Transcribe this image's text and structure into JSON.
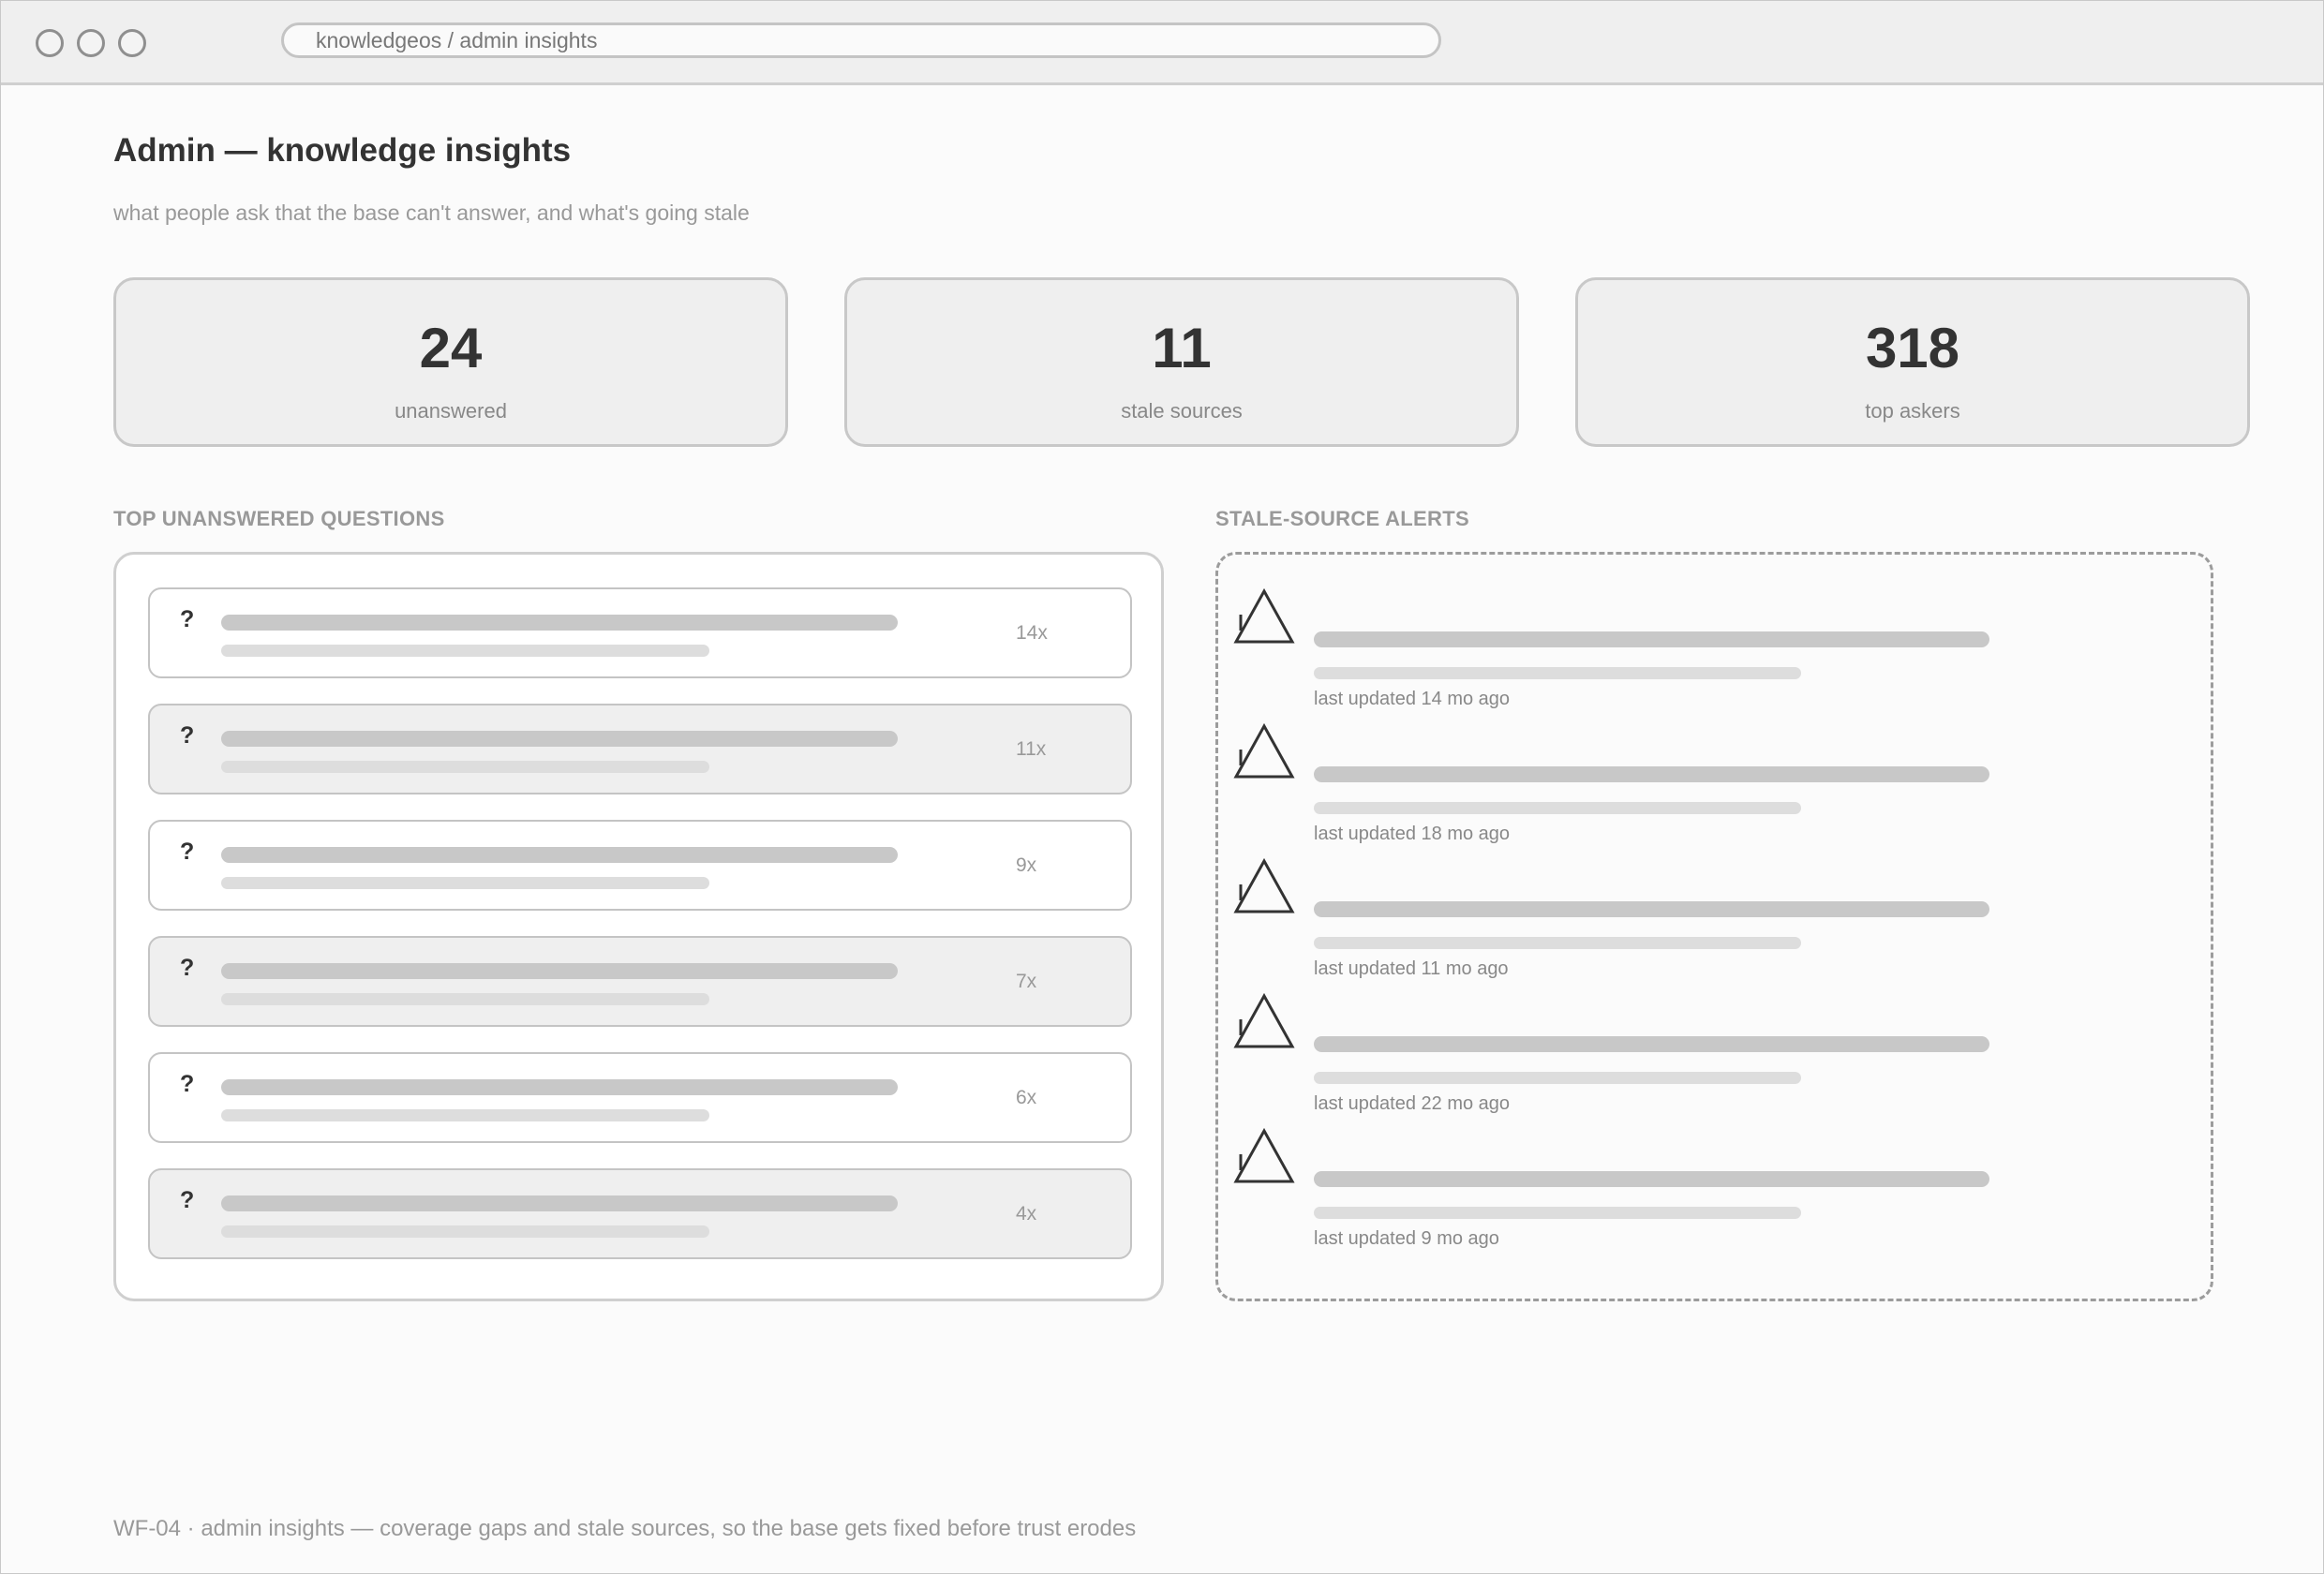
{
  "browser": {
    "address": "knowledgeos / admin insights"
  },
  "page": {
    "title": "Admin — knowledge insights",
    "subtitle": "what people ask that the base can't answer, and what's going stale"
  },
  "stats": [
    {
      "value": "24",
      "label": "unanswered"
    },
    {
      "value": "11",
      "label": "stale sources"
    },
    {
      "value": "318",
      "label": "top askers"
    }
  ],
  "questions": {
    "heading": "TOP UNANSWERED QUESTIONS",
    "items": [
      {
        "icon": "?",
        "count": "14x"
      },
      {
        "icon": "?",
        "count": "11x"
      },
      {
        "icon": "?",
        "count": "9x"
      },
      {
        "icon": "?",
        "count": "7x"
      },
      {
        "icon": "?",
        "count": "6x"
      },
      {
        "icon": "?",
        "count": "4x"
      }
    ]
  },
  "alerts": {
    "heading": "STALE-SOURCE ALERTS",
    "icon": "warning-triangle-icon",
    "items": [
      {
        "meta": "last updated 14 mo ago"
      },
      {
        "meta": "last updated 18 mo ago"
      },
      {
        "meta": "last updated 11 mo ago"
      },
      {
        "meta": "last updated 22 mo ago"
      },
      {
        "meta": "last updated 9 mo ago"
      }
    ]
  },
  "footer": {
    "caption": "WF-04 · admin insights — coverage gaps and stale sources, so the base gets fixed before trust erodes"
  }
}
